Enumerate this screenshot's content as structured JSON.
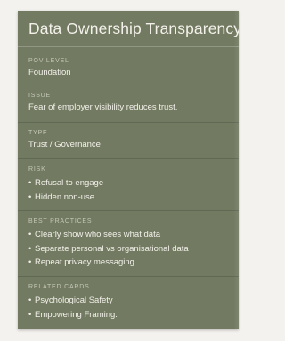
{
  "card": {
    "title": "Data Ownership Transparency",
    "sections": [
      {
        "label": "POV LEVEL",
        "value": "Foundation"
      },
      {
        "label": "ISSUE",
        "value": "Fear of employer visibility reduces trust."
      },
      {
        "label": "TYPE",
        "value": "Trust / Governance"
      },
      {
        "label": "RISK",
        "items": [
          "Refusal to engage",
          "Hidden non-use"
        ]
      },
      {
        "label": "BEST PRACTICES",
        "items": [
          "Clearly show who sees what data",
          "Separate personal vs organisational data",
          "Repeat privacy messaging."
        ]
      },
      {
        "label": "RELATED CARDS",
        "items": [
          "Psychological Safety",
          "Empowering Framing."
        ]
      }
    ],
    "bullet": "•"
  }
}
